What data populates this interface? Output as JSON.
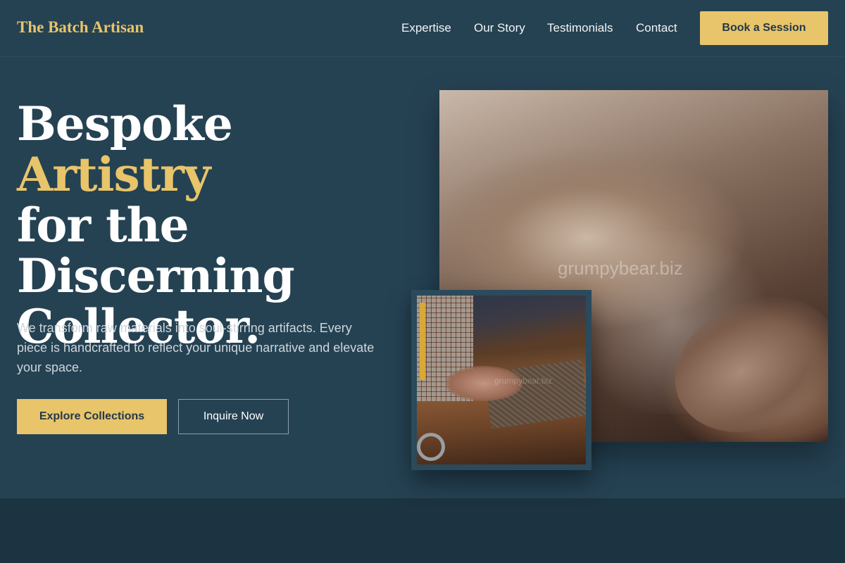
{
  "header": {
    "logo": "The Batch Artisan",
    "nav": [
      "Expertise",
      "Our Story",
      "Testimonials",
      "Contact"
    ],
    "cta": "Book a Session"
  },
  "hero": {
    "headline_part1": "Bespoke ",
    "headline_accent": "Artistry",
    "headline_part2": "for the Discerning Collector.",
    "subtext": "We transform raw materials into soul-stirring artifacts. Every piece is handcrafted to reflect your unique narrative and elevate your space.",
    "primary_button": "Explore Collections",
    "secondary_button": "Inquire Now"
  },
  "images": {
    "main_watermark": "grumpybear.biz",
    "small_watermark": "grumpybear.biz"
  },
  "colors": {
    "accent": "#e8c46a",
    "background": "#254253",
    "footer_band": "#1c3442"
  },
  "icons": []
}
